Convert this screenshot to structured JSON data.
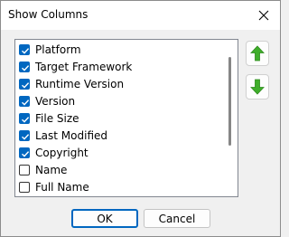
{
  "dialog": {
    "title": "Show Columns",
    "close_icon": "close-icon"
  },
  "columns": [
    {
      "label": "Platform",
      "checked": true
    },
    {
      "label": "Target Framework",
      "checked": true
    },
    {
      "label": "Runtime Version",
      "checked": true
    },
    {
      "label": "Version",
      "checked": true
    },
    {
      "label": "File Size",
      "checked": true
    },
    {
      "label": "Last Modified",
      "checked": true
    },
    {
      "label": "Copyright",
      "checked": true
    },
    {
      "label": "Name",
      "checked": false
    },
    {
      "label": "Full Name",
      "checked": false
    }
  ],
  "move_buttons": {
    "up_icon": "arrow-up-icon",
    "down_icon": "arrow-down-icon",
    "arrow_color": "#3fae2a"
  },
  "footer": {
    "ok_label": "OK",
    "cancel_label": "Cancel"
  },
  "colors": {
    "accent": "#0067c0"
  }
}
